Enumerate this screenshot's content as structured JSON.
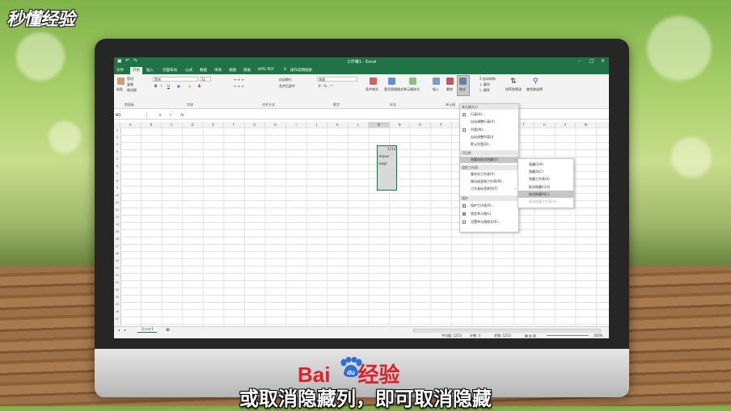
{
  "watermark": {
    "logo": "秒懂经验",
    "brand_text": "Bai",
    "brand_du": "du",
    "brand_jingyan": "经验"
  },
  "caption": "或取消隐藏列，即可取消隐藏",
  "excel": {
    "title": "工作簿1 - Excel",
    "tabs": [
      "文件",
      "开始",
      "插入",
      "页面布局",
      "公式",
      "数据",
      "审阅",
      "视图",
      "帮助",
      "WPS PDF"
    ],
    "active_tab": 1,
    "tell_me": "操作说明搜索",
    "ribbon": {
      "paste": "粘贴",
      "cut": "剪切",
      "copy": "复制",
      "format_painter": "格式刷",
      "font_name": "等线",
      "font_size": "11",
      "wrap_text": "自动换行",
      "merge_center": "合并后居中",
      "number_format": "常规",
      "cond_format": "条件格式",
      "format_table": "套用表格格式",
      "cell_styles": "单元格样式",
      "insert": "插入",
      "delete": "删除",
      "format": "格式",
      "autosum": "自动求和",
      "fill": "填充",
      "clear": "清除",
      "sort_filter": "排序和筛选",
      "find_select": "查找和选择",
      "groups": {
        "clipboard": "剪贴板",
        "font": "字体",
        "alignment": "对齐方式",
        "number": "数字",
        "styles": "样式",
        "cells": "单元格",
        "editing": "编辑"
      }
    },
    "name_box": "M3",
    "columns": [
      "A",
      "B",
      "C",
      "D",
      "E",
      "F",
      "G",
      "H",
      "I",
      "J",
      "K",
      "L",
      "M",
      "N",
      "O",
      "P",
      "Q",
      "R",
      "S",
      "T",
      "U",
      "V",
      "W"
    ],
    "selected_column": "M",
    "rows": [
      "1",
      "2",
      "3",
      "4",
      "5",
      "6",
      "7",
      "8",
      "9",
      "10",
      "11",
      "12",
      "13",
      "14",
      "15",
      "16",
      "17",
      "18",
      "19",
      "20",
      "21",
      "22",
      "23",
      "24",
      "25",
      "26",
      "27"
    ],
    "cells": {
      "m3": "1213",
      "m4": "dsaaer",
      "m5": "eiegt"
    },
    "format_menu": {
      "header_size": "单元格大小",
      "row_height": "行高(H)...",
      "autofit_row": "自动调整行高(A)",
      "col_width": "列宽(W)...",
      "autofit_col": "自动调整列宽(I)",
      "default_width": "默认列宽(D)...",
      "header_visibility": "可见性",
      "hide_unhide": "隐藏和取消隐藏(U)",
      "header_organize": "组织工作表",
      "rename": "重命名工作表(R)",
      "move_copy": "移动或复制工作表(M)...",
      "tab_color": "工作表标签颜色(T)",
      "header_protect": "保护",
      "protect_sheet": "保护工作表(P)...",
      "lock_cell": "锁定单元格(L)",
      "format_cells": "设置单元格格式(E)..."
    },
    "submenu": {
      "hide_rows": "隐藏行(R)",
      "hide_cols": "隐藏列(C)",
      "hide_sheet": "隐藏工作表(S)",
      "unhide_rows": "取消隐藏行(O)",
      "unhide_cols": "取消隐藏列(L)",
      "unhide_sheet": "取消隐藏工作表(H)..."
    },
    "sheet_tab": "Sheet1",
    "status": {
      "average": "平均值: 1213",
      "count": "计数: 3",
      "sum": "求和: 1213",
      "zoom": "100%"
    }
  }
}
